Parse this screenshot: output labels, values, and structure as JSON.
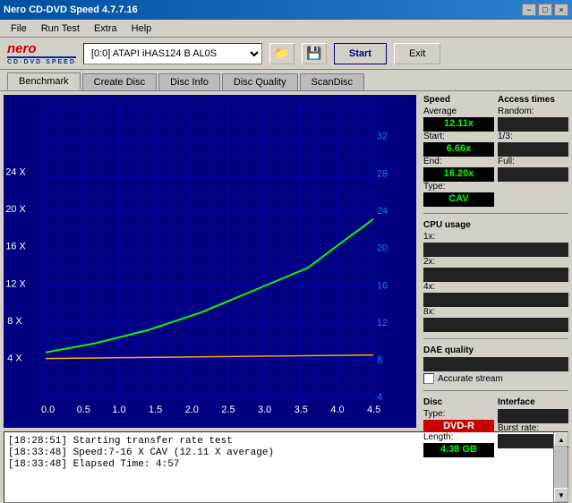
{
  "titleBar": {
    "title": "Nero CD-DVD Speed 4.7.7.16",
    "buttons": [
      "−",
      "□",
      "×"
    ]
  },
  "menuBar": {
    "items": [
      "File",
      "Run Test",
      "Extra",
      "Help"
    ]
  },
  "toolbar": {
    "driveLabel": "[0:0]  ATAPI iHAS124  B AL0S",
    "startLabel": "Start",
    "exitLabel": "Exit"
  },
  "tabs": {
    "items": [
      "Benchmark",
      "Create Disc",
      "Disc Info",
      "Disc Quality",
      "ScanDisc"
    ],
    "active": "Benchmark"
  },
  "chart": {
    "xLabels": [
      "0.0",
      "0.5",
      "1.0",
      "1.5",
      "2.0",
      "2.5",
      "3.0",
      "3.5",
      "4.0",
      "4.5"
    ],
    "yLeftLabels": [
      "4 X",
      "8 X",
      "12 X",
      "16 X",
      "20 X",
      "24 X"
    ],
    "yRightLabels": [
      "4",
      "8",
      "12",
      "16",
      "20",
      "24",
      "28",
      "32"
    ]
  },
  "rightPanel": {
    "speedTitle": "Speed",
    "averageLabel": "Average",
    "averageValue": "12.11x",
    "startLabel": "Start:",
    "startValue": "6.66x",
    "endLabel": "End:",
    "endValue": "16.20x",
    "typeLabel": "Type:",
    "typeValue": "CAV",
    "accessTitle": "Access times",
    "randomLabel": "Random:",
    "randomValue": "",
    "oneThirdLabel": "1/3:",
    "oneThirdValue": "",
    "fullLabel": "Full:",
    "fullValue": "",
    "cpuTitle": "CPU usage",
    "cpu1xLabel": "1x:",
    "cpu1xValue": "",
    "cpu2xLabel": "2x:",
    "cpu2xValue": "",
    "cpu4xLabel": "4x:",
    "cpu4xValue": "",
    "cpu8xLabel": "8x:",
    "cpu8xValue": "",
    "daeTitle": "DAE quality",
    "daeValue": "",
    "accurateLabel": "Accurate stream",
    "discTitle": "Disc",
    "discTypeLabel": "Type:",
    "discTypeValue": "DVD-R",
    "lengthLabel": "Length:",
    "lengthValue": "4.38 GB",
    "interfaceTitle": "Interface",
    "burstTitle": "Burst rate:"
  },
  "statusLog": {
    "entries": [
      {
        "time": "[18:28:51]",
        "text": "Starting transfer rate test"
      },
      {
        "time": "[18:33:48]",
        "text": "Speed:7-16 X CAV (12.11 X average)"
      },
      {
        "time": "[18:33:48]",
        "text": "Elapsed Time: 4:57"
      }
    ]
  }
}
